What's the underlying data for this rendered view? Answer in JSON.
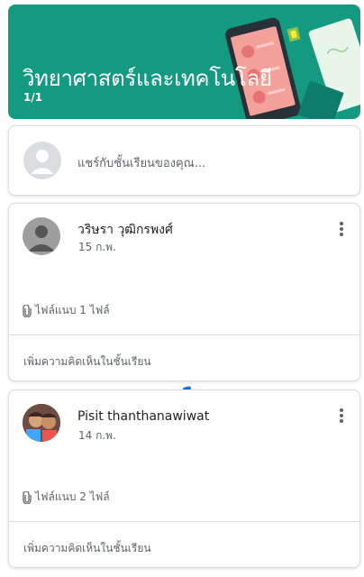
{
  "banner": {
    "title": "วิทยาศาสตร์และเทคโนโลยี",
    "subtitle": "1/1",
    "bg_color": "#159a82"
  },
  "share": {
    "placeholder": "แชร์กับชั้นเรียนของคุณ..."
  },
  "posts": [
    {
      "author": "วริษรา วุฒิกรพงศ์",
      "date": "15 ก.พ.",
      "attachments": "ไฟล์แนบ 1 ไฟล์",
      "comment_placeholder": "เพิ่มความคิดเห็นในชั้นเรียน",
      "more_icon": "more-vert-icon"
    },
    {
      "author": "Pisit thanthanawiwat",
      "date": "14 ก.พ.",
      "attachments": "ไฟล์แนบ 2 ไฟล์",
      "comment_placeholder": "เพิ่มความคิดเห็นในชั้นเรียน",
      "more_icon": "more-vert-icon"
    }
  ]
}
